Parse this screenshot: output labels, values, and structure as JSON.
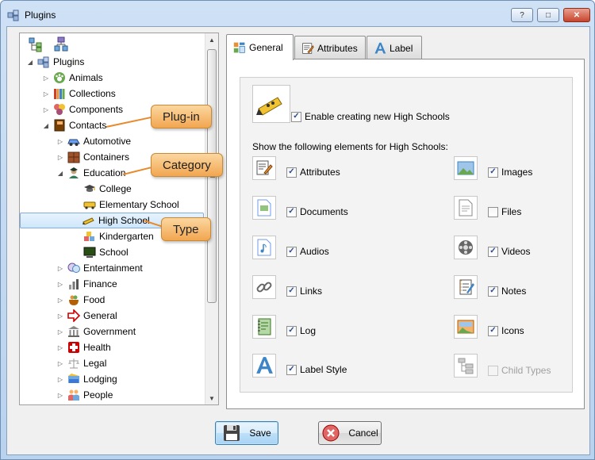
{
  "window": {
    "title": "Plugins",
    "buttons": {
      "help": "?",
      "restore": "□",
      "close": "✕"
    }
  },
  "tree": {
    "items": [
      {
        "label": "Plugins",
        "expander": "expanded",
        "icon": "puzzle-icon",
        "level": 0
      },
      {
        "label": "Animals",
        "expander": "collapsed",
        "icon": "paw-icon",
        "level": 1
      },
      {
        "label": "Collections",
        "expander": "collapsed",
        "icon": "books-icon",
        "level": 1
      },
      {
        "label": "Components",
        "expander": "collapsed",
        "icon": "components-icon",
        "level": 1
      },
      {
        "label": "Contacts",
        "expander": "expanded",
        "icon": "address-book-icon",
        "level": 1
      },
      {
        "label": "Automotive",
        "expander": "collapsed",
        "icon": "car-icon",
        "level": 2
      },
      {
        "label": "Containers",
        "expander": "collapsed",
        "icon": "crate-icon",
        "level": 2
      },
      {
        "label": "Education",
        "expander": "expanded",
        "icon": "student-icon",
        "level": 2
      },
      {
        "label": "College",
        "expander": "none",
        "icon": "mortarboard-icon",
        "level": 3
      },
      {
        "label": "Elementary School",
        "expander": "none",
        "icon": "school-bus-icon",
        "level": 3
      },
      {
        "label": "High School",
        "expander": "none",
        "icon": "pencil-icon",
        "level": 3,
        "selected": true
      },
      {
        "label": "Kindergarten",
        "expander": "none",
        "icon": "blocks-icon",
        "level": 3
      },
      {
        "label": "School",
        "expander": "none",
        "icon": "blackboard-icon",
        "level": 3
      },
      {
        "label": "Entertainment",
        "expander": "collapsed",
        "icon": "masks-icon",
        "level": 2
      },
      {
        "label": "Finance",
        "expander": "collapsed",
        "icon": "finance-icon",
        "level": 2
      },
      {
        "label": "Food",
        "expander": "collapsed",
        "icon": "food-icon",
        "level": 2
      },
      {
        "label": "General",
        "expander": "collapsed",
        "icon": "arrow-right-icon",
        "level": 2
      },
      {
        "label": "Government",
        "expander": "collapsed",
        "icon": "government-icon",
        "level": 2
      },
      {
        "label": "Health",
        "expander": "collapsed",
        "icon": "red-cross-icon",
        "level": 2
      },
      {
        "label": "Legal",
        "expander": "collapsed",
        "icon": "scales-icon",
        "level": 2
      },
      {
        "label": "Lodging",
        "expander": "collapsed",
        "icon": "lodging-icon",
        "level": 2
      },
      {
        "label": "People",
        "expander": "collapsed",
        "icon": "people-icon",
        "level": 2
      }
    ]
  },
  "callouts": {
    "plugin": "Plug-in",
    "category": "Category",
    "type": "Type"
  },
  "tabs": [
    {
      "label": "General",
      "icon": "general-tab-icon",
      "active": true
    },
    {
      "label": "Attributes",
      "icon": "attributes-tab-icon",
      "active": false
    },
    {
      "label": "Label",
      "icon": "label-tab-icon",
      "active": false
    }
  ],
  "general": {
    "enable_label": "Enable creating new High Schools",
    "enable_checked": true,
    "section_label": "Show the following elements for High Schools:",
    "options_left": [
      {
        "label": "Attributes",
        "checked": true,
        "icon": "attributes-icon"
      },
      {
        "label": "Documents",
        "checked": true,
        "icon": "documents-icon"
      },
      {
        "label": "Audios",
        "checked": true,
        "icon": "audio-icon"
      },
      {
        "label": "Links",
        "checked": true,
        "icon": "link-icon"
      },
      {
        "label": "Log",
        "checked": true,
        "icon": "log-icon"
      },
      {
        "label": "Label Style",
        "checked": true,
        "icon": "label-style-icon"
      }
    ],
    "options_right": [
      {
        "label": "Images",
        "checked": true,
        "icon": "images-icon",
        "disabled": false
      },
      {
        "label": "Files",
        "checked": false,
        "icon": "files-icon",
        "disabled": false
      },
      {
        "label": "Videos",
        "checked": true,
        "icon": "video-icon",
        "disabled": false
      },
      {
        "label": "Notes",
        "checked": true,
        "icon": "notes-icon",
        "disabled": false
      },
      {
        "label": "Icons",
        "checked": true,
        "icon": "icons-icon",
        "disabled": false
      },
      {
        "label": "Child Types",
        "checked": false,
        "icon": "child-types-icon",
        "disabled": true
      }
    ]
  },
  "footer": {
    "save_label": "Save",
    "cancel_label": "Cancel"
  },
  "colors": {
    "callout_fill": "#f2a650",
    "callout_line": "#e88a2c",
    "selection": "#cfe6fb"
  }
}
